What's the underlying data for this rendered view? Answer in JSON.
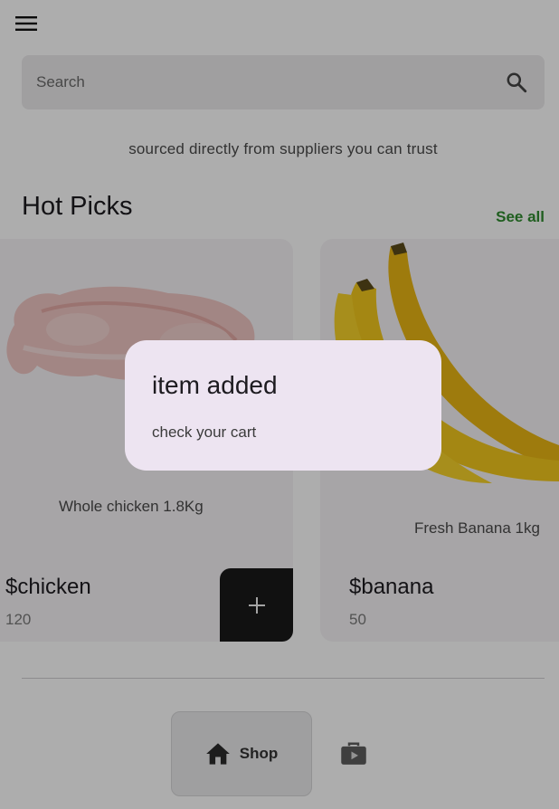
{
  "search": {
    "placeholder": "Search",
    "icon": "search-icon"
  },
  "tagline": "sourced directly from suppliers you can trust",
  "hot_picks": {
    "title": "Hot Picks",
    "see_all_label": "See all",
    "see_all_color": "#2e8b2e",
    "products": [
      {
        "description": "Whole chicken 1.8Kg",
        "name": "$chicken",
        "price": "120"
      },
      {
        "description": "Fresh Banana 1kg",
        "name": "$banana",
        "price": "50"
      }
    ]
  },
  "add_button": {
    "icon": "plus-icon"
  },
  "bottom_nav": {
    "items": [
      {
        "label": "Shop",
        "icon": "home-icon",
        "active": true
      },
      {
        "label": "",
        "icon": "video-bag-icon",
        "active": false
      }
    ]
  },
  "dialog": {
    "title": "item added",
    "body": "check your cart"
  }
}
